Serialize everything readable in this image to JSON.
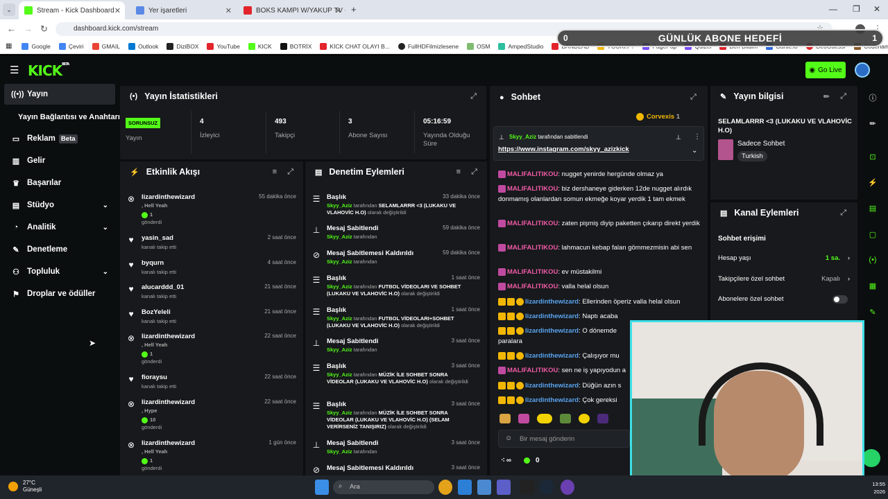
{
  "browser": {
    "tabs": [
      "Stream - Kick Dashboard",
      "Yer işaretleri",
      "BOKS KAMPI W/YAKUP TV - Yo"
    ],
    "url": "dashboard.kick.com/stream",
    "bookmarks": [
      "Google",
      "Çeviri",
      "GMAIL",
      "Outlook",
      "DiziBOX",
      "YouTube",
      "KICK",
      "BOTRİX",
      "KİCK CHAT OLAYI B...",
      "FullHDFilmizlesene",
      "OSM",
      "AmpedStudio",
      "BANDLAB",
      "YOUKI!P?",
      "PagePop",
      "Quizei",
      "Ben Bildim",
      "Gartic.io",
      "GeoGuessr",
      "Codenames"
    ]
  },
  "goal": {
    "label": "GÜNLÜK ABONE HEDEFİ",
    "current": "0",
    "target": "1"
  },
  "header": {
    "go_live": "Go Live"
  },
  "sidebar": {
    "items": [
      {
        "label": "Yayın"
      },
      {
        "label": "Yayın Bağlantısı ve Anahtarı"
      },
      {
        "label": "Reklam",
        "beta": "Beta"
      },
      {
        "label": "Gelir"
      },
      {
        "label": "Başarılar"
      },
      {
        "label": "Stüdyo"
      },
      {
        "label": "Analitik"
      },
      {
        "label": "Denetleme"
      },
      {
        "label": "Topluluk"
      },
      {
        "label": "Droplar ve ödüller"
      }
    ]
  },
  "stats": {
    "title": "Yayın İstatistikleri",
    "status_badge": "SORUNSUZ",
    "status_label": "Yayın",
    "items": [
      {
        "value": "4",
        "label": "İzleyici"
      },
      {
        "value": "493",
        "label": "Takipçi"
      },
      {
        "value": "3",
        "label": "Abone Sayısı"
      },
      {
        "value": "05:16:59",
        "label": "Yayında Olduğu Süre"
      }
    ]
  },
  "activity": {
    "title": "Etkinlik Akışı",
    "rows": [
      {
        "name": "lizardinthewizard",
        "time": "55 dakika önce",
        "line1": ", Hell Yeah",
        "count": "1",
        "line3": "gönderdi"
      },
      {
        "name": "yasin_sad",
        "time": "2 saat önce",
        "line1": "kanalı takip etti"
      },
      {
        "name": "byqurn",
        "time": "4 saat önce",
        "line1": "kanalı takip etti"
      },
      {
        "name": "alucarddd_01",
        "time": "21 saat önce",
        "line1": "kanalı takip etti"
      },
      {
        "name": "BozYeleli",
        "time": "21 saat önce",
        "line1": "kanalı takip etti"
      },
      {
        "name": "lizardinthewizard",
        "time": "22 saat önce",
        "line1": ", Hell Yeah",
        "count": "1",
        "line3": "gönderdi"
      },
      {
        "name": "fioraysu",
        "time": "22 saat önce",
        "line1": "kanalı takip etti"
      },
      {
        "name": "lizardinthewizard",
        "time": "22 saat önce",
        "line1": ", Hype",
        "count": "10",
        "line3": "gönderdi"
      },
      {
        "name": "lizardinthewizard",
        "time": "1 gün önce",
        "line1": ", Hell Yeah",
        "count": "1",
        "line3": "gönderdi"
      }
    ]
  },
  "moderation": {
    "title": "Denetim Eylemleri",
    "rows": [
      {
        "title": "Başlık",
        "time": "33 dakika önce",
        "user": "Skyy_Aziz",
        "mid": "tarafından",
        "value": "SELAMLARRR <3 (LUKAKU VE VLAHOVİC H.O)",
        "tail": "olarak değiştirildi"
      },
      {
        "title": "Mesaj Sabitlendi",
        "time": "59 dakika önce",
        "user": "Skyy_Aziz",
        "mid": "tarafından"
      },
      {
        "title": "Mesaj Sabitlemesi Kaldırıldı",
        "time": "59 dakika önce",
        "user": "Skyy_Aziz",
        "mid": "tarafından"
      },
      {
        "title": "Başlık",
        "time": "1 saat önce",
        "user": "Skyy_Aziz",
        "mid": "tarafından",
        "value": "FUTBOL VİDEOLARI VE SOHBET (LUKAKU VE VLAHOVİC H.O)",
        "tail": "olarak değiştirildi"
      },
      {
        "title": "Başlık",
        "time": "1 saat önce",
        "user": "Skyy_Aziz",
        "mid": "tarafından",
        "value": "FUTBOL VİDEOLARI+SOHBET (LUKAKU VE VLAHOVİC H.O)",
        "tail": "olarak değiştirildi"
      },
      {
        "title": "Mesaj Sabitlendi",
        "time": "3 saat önce",
        "user": "Skyy_Aziz",
        "mid": "tarafından"
      },
      {
        "title": "Başlık",
        "time": "3 saat önce",
        "user": "Skyy_Aziz",
        "mid": "tarafından",
        "value": "MÜZİK İLE SOHBET SONRA VİDEOLAR (LUKAKU VE VLAHOVİC H.O)",
        "tail": "olarak değiştirildi"
      },
      {
        "title": "Başlık",
        "time": "3 saat önce",
        "user": "Skyy_Aziz",
        "mid": "tarafından",
        "value": "MÜZİK İLE SOHBET SONRA VİDEOLAR (LUKAKU VE VLAHOVİC H.O) (SELAM VERİRSENİZ TANIŞIRIZ)",
        "tail": "olarak değiştirildi"
      },
      {
        "title": "Mesaj Sabitlendi",
        "time": "3 saat önce",
        "user": "Skyy_Aziz",
        "mid": "tarafından"
      },
      {
        "title": "Mesaj Sabitlemesi Kaldırıldı",
        "time": "3 saat önce"
      }
    ]
  },
  "chat": {
    "title": "Sohbet",
    "top_gifter": "Corvexis",
    "top_gifter_count": "1",
    "pinned": {
      "by_user": "Skyy_Aziz",
      "by_text": "tarafından sabitlendi",
      "link": "https://www.instagram.com/skyy_azizkick"
    },
    "messages": [
      {
        "user": "MALIFALITIKOU",
        "text": "nugget yenirde hergünde olmaz ya",
        "color": "pink"
      },
      {
        "user": "MALIFALITIKOU",
        "text": "biz dershaneye giderken 12de nugget alırdık donmamış olanlardan somun ekmeğe koyar yerdik 1 tam ekmek",
        "color": "pink"
      },
      {
        "user": "MALIFALITIKOU",
        "text": "zaten pişmiş diyip paketten çıkarıp direkt yerdik",
        "color": "pink"
      },
      {
        "user": "MALIFALITIKOU",
        "text": "lahmacun kebap falan gömmezmisin abi sen",
        "color": "pink"
      },
      {
        "user": "MALIFALITIKOU",
        "text": "ev müstakilmi",
        "color": "pink"
      },
      {
        "user": "MALIFALITIKOU",
        "text": "valla helal olsun",
        "color": "pink"
      },
      {
        "user": "lizardinthewizard",
        "text": "Ellerinden öperiz valla helal olsun",
        "color": "blue"
      },
      {
        "user": "lizardinthewizard",
        "text": "Naptı acaba",
        "color": "blue"
      },
      {
        "user": "lizardinthewizard",
        "text": "O dönemde paralara",
        "color": "blue"
      },
      {
        "user": "lizardinthewizard",
        "text": "Çalışıyor mu",
        "color": "blue"
      },
      {
        "user": "MALIFALITIKOU",
        "text": "sen ne iş yapıyodun a",
        "color": "pink"
      },
      {
        "user": "lizardinthewizard",
        "text": "Düğün azın s",
        "color": "blue"
      },
      {
        "user": "lizardinthewizard",
        "text": "Çok gereksi",
        "color": "blue"
      }
    ],
    "input_placeholder": "Bir mesaj gönderin",
    "infinity": "∞",
    "points": "0"
  },
  "stream_info": {
    "title": "Yayın bilgisi",
    "stream_title": "SELAMLARRR <3 (LUKAKU VE VLAHOVİC H.O)",
    "category": "Sadece Sohbet",
    "language": "Turkish"
  },
  "channel_actions": {
    "title": "Kanal Eylemleri",
    "section": "Sohbet erişimi",
    "rows": [
      {
        "label": "Hesap yaşı",
        "value": "1 sa."
      },
      {
        "label": "Takipçilere özel sohbet",
        "value": "Kapalı"
      },
      {
        "label": "Abonelere özel sohbet",
        "value": ""
      }
    ]
  },
  "taskbar": {
    "weather_temp": "27°C",
    "weather_desc": "Güneşli",
    "search": "Ara",
    "time": "13:55",
    "date": "2026"
  }
}
